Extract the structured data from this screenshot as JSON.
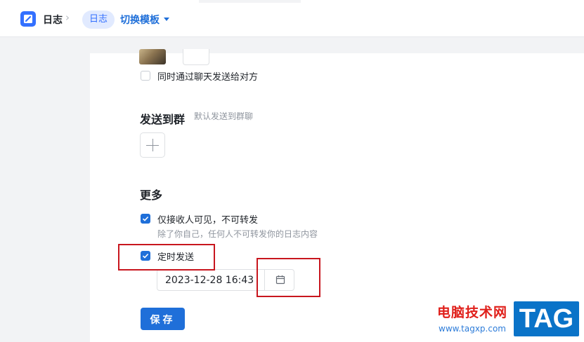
{
  "header": {
    "app_name": "日志",
    "breadcrumb_separator": "›",
    "template_pill": "日志",
    "switch_template_label": "切换模板"
  },
  "recipients": {
    "send_via_chat_label": "同时通过聊天发送给对方",
    "send_via_chat_checked": false
  },
  "send_to_group": {
    "title": "发送到群",
    "hint": "默认发送到群聊"
  },
  "more": {
    "title": "更多",
    "receiver_only_label": "仅接收人可见，不可转发",
    "receiver_only_checked": true,
    "receiver_only_hint": "除了你自己，任何人不可转发你的日志内容",
    "scheduled_send_label": "定时发送",
    "scheduled_send_checked": true,
    "scheduled_datetime": "2023-12-28 16:43"
  },
  "actions": {
    "save_label": "保存"
  },
  "watermark": {
    "site_name": "电脑技术网",
    "url": "www.tagxp.com",
    "badge": "TAG"
  },
  "colors": {
    "accent": "#1f6fd9",
    "highlight_box": "#c8161e"
  }
}
